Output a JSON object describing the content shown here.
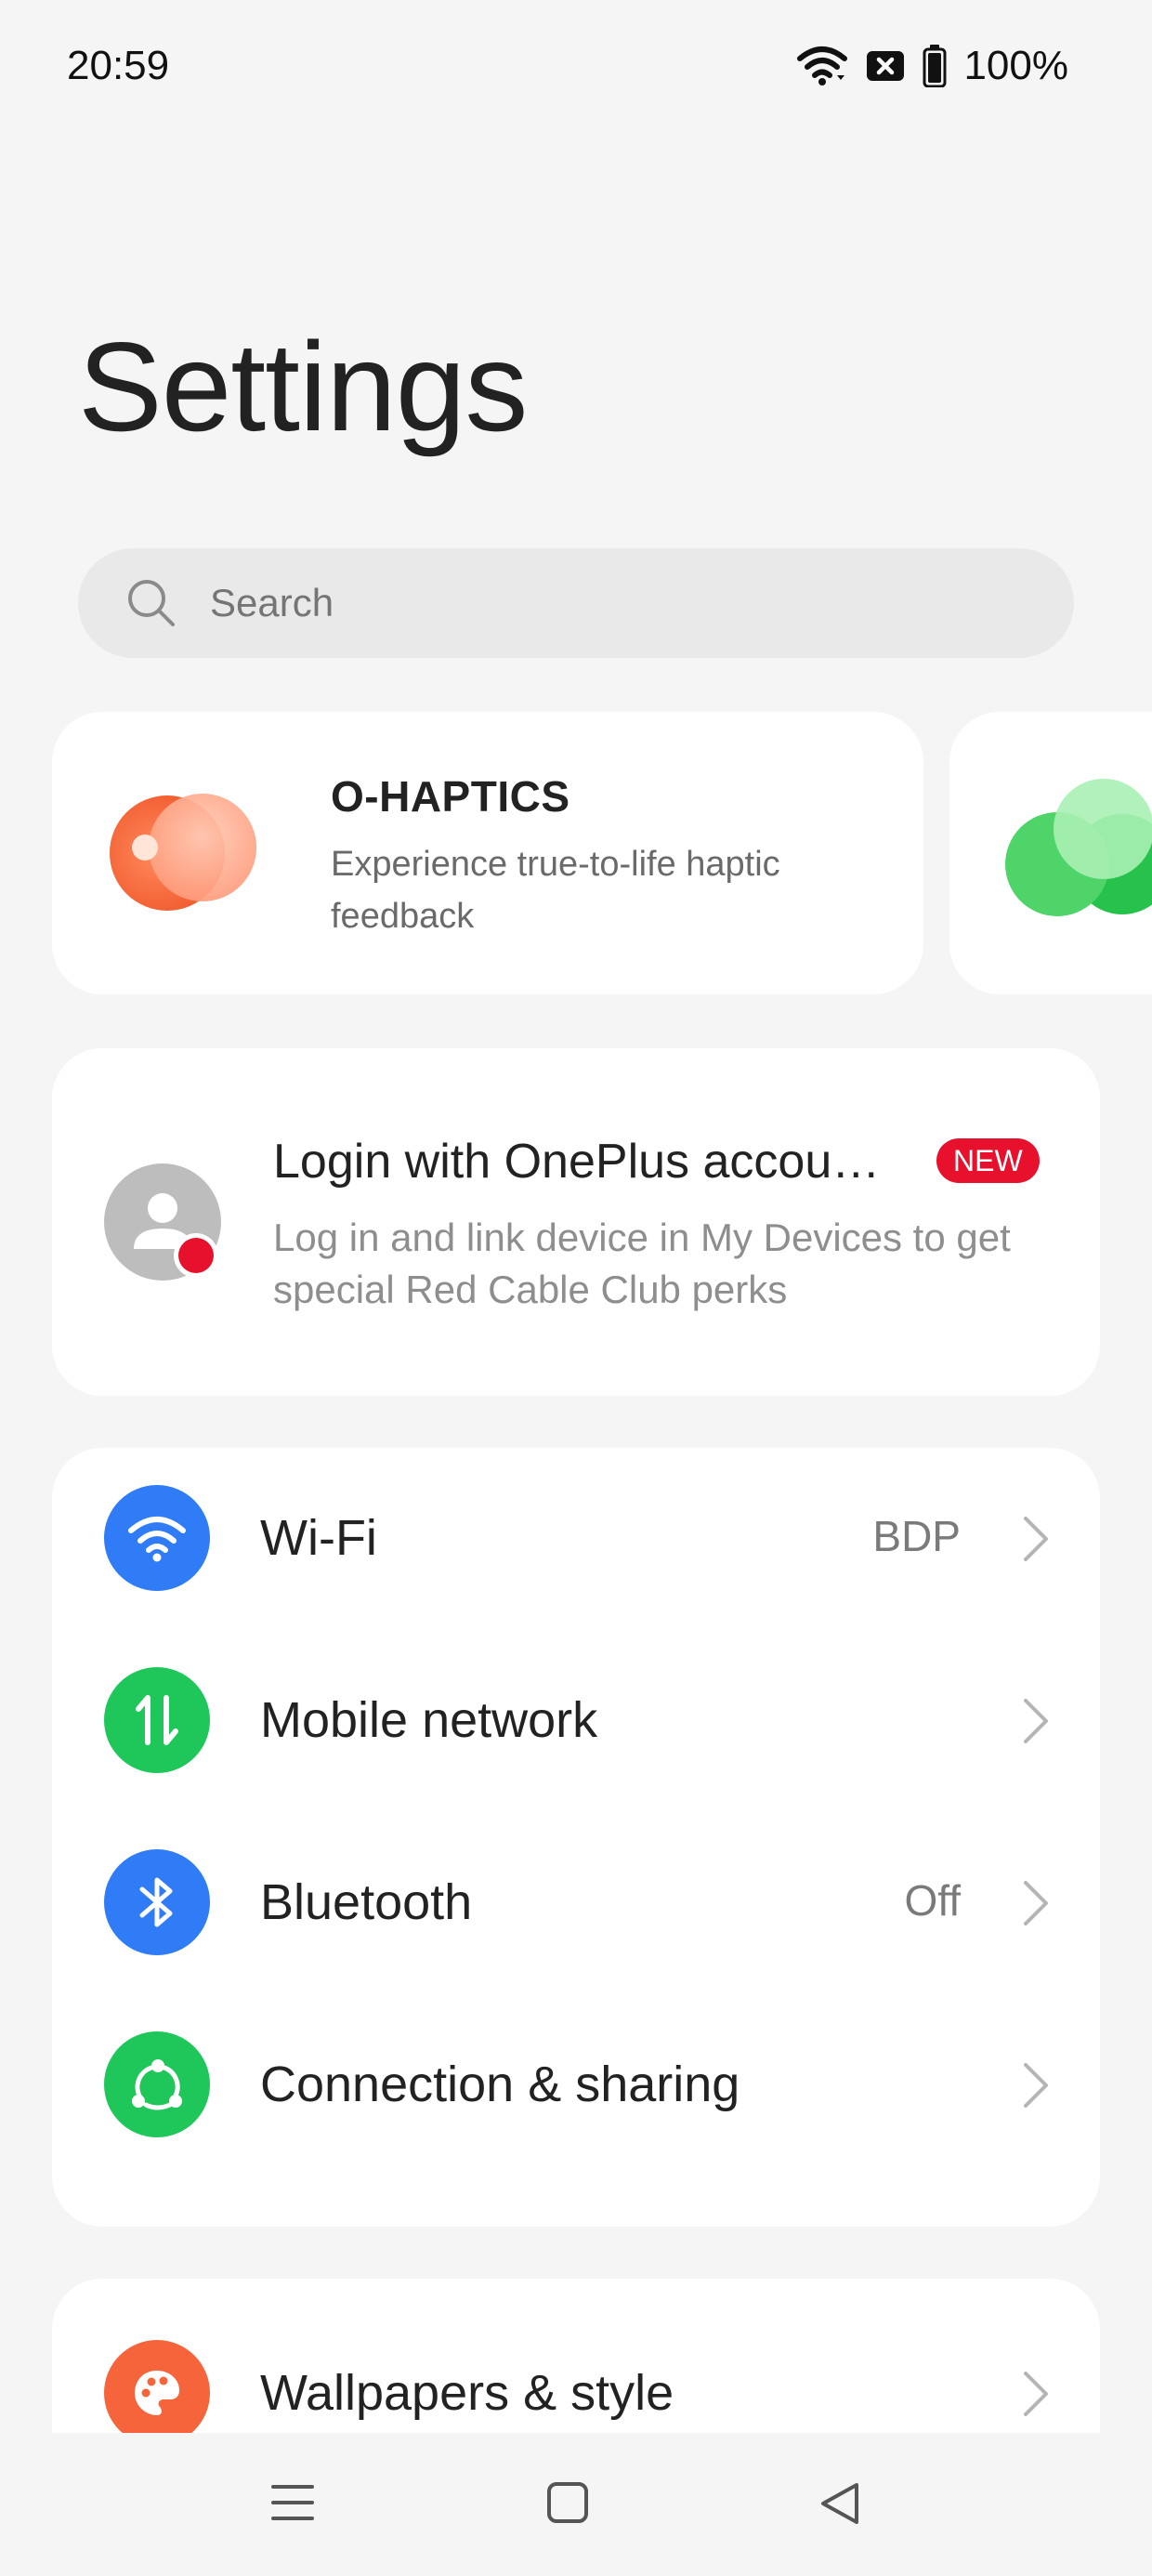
{
  "status_bar": {
    "time": "20:59",
    "battery": "100%",
    "icons": [
      "wifi-icon",
      "no-sim-icon",
      "battery-icon"
    ]
  },
  "page": {
    "title": "Settings"
  },
  "search": {
    "placeholder": "Search"
  },
  "feature_cards": [
    {
      "title": "O-HAPTICS",
      "description": "Experience true-to-life haptic feedback",
      "icon": "haptics-art-icon"
    },
    {
      "title": "",
      "icon": "green-circles-art-icon"
    }
  ],
  "login_card": {
    "title": "Login with OnePlus accou…",
    "badge": "NEW",
    "description": "Log in and link device in My Devices to get special Red Cable Club perks",
    "icon": "account-avatar-icon"
  },
  "connectivity": [
    {
      "label": "Wi-Fi",
      "value": "BDP",
      "icon": "wifi-icon",
      "color": "#2f7cf6"
    },
    {
      "label": "Mobile network",
      "value": "",
      "icon": "mobile-data-icon",
      "color": "#1fc65a"
    },
    {
      "label": "Bluetooth",
      "value": "Off",
      "icon": "bluetooth-icon",
      "color": "#2f7cf6"
    },
    {
      "label": "Connection & sharing",
      "value": "",
      "icon": "connection-sharing-icon",
      "color": "#1fc65a"
    }
  ],
  "personalization": [
    {
      "label": "Wallpapers & style",
      "value": "",
      "icon": "palette-icon",
      "color": "#f5643a"
    }
  ],
  "nav_bar": {
    "buttons": [
      "menu-icon",
      "home-icon",
      "back-icon"
    ]
  },
  "colors": {
    "background": "#f5f5f5",
    "card": "#ffffff",
    "badge": "#e8112d",
    "blue": "#2f7cf6",
    "green": "#1fc65a",
    "orange": "#f5643a"
  }
}
